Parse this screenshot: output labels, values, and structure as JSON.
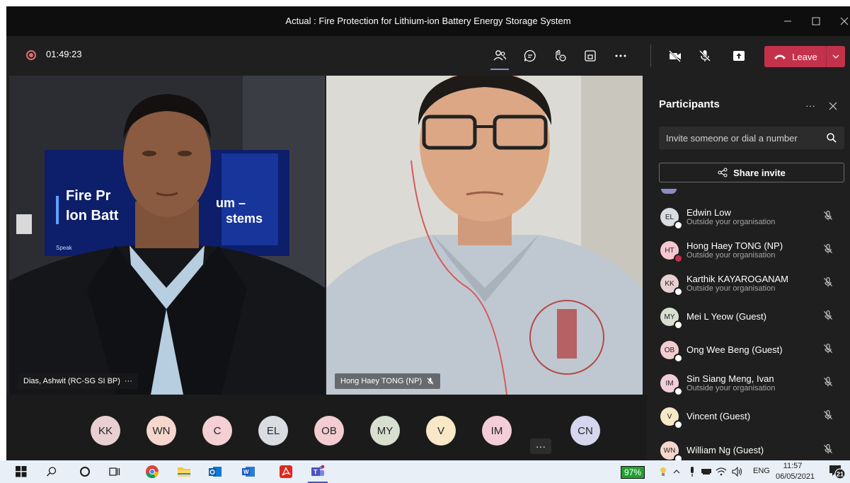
{
  "window": {
    "title": "Actual : Fire Protection for Lithium-ion Battery Energy Storage System"
  },
  "toolbar": {
    "elapsed": "01:49:23",
    "leave_label": "Leave"
  },
  "videos": [
    {
      "name": "Dias, Ashwit (RC-SG SI BP)",
      "more": "···",
      "slide_text": [
        "Fire Pr",
        "um –",
        "Ion Batt",
        "stems",
        "Speak"
      ]
    },
    {
      "name": "Hong Haey TONG (NP)"
    }
  ],
  "strip": {
    "avatars": [
      {
        "initials": "KK",
        "color": "#e8d0d2"
      },
      {
        "initials": "WN",
        "color": "#f6d7cd"
      },
      {
        "initials": "C",
        "color": "#f4cfd4"
      },
      {
        "initials": "EL",
        "color": "#d9dce1"
      },
      {
        "initials": "OB",
        "color": "#f2ccd1"
      },
      {
        "initials": "MY",
        "color": "#d8ded0"
      },
      {
        "initials": "V",
        "color": "#f8e8c6"
      },
      {
        "initials": "IM",
        "color": "#f3cdd7"
      },
      {
        "initials": "CN",
        "color": "#d6d7ee"
      }
    ],
    "more": "···"
  },
  "participants": {
    "title": "Participants",
    "more": "···",
    "search_placeholder": "Invite someone or dial a number",
    "share_label": "Share invite",
    "items": [
      {
        "initials": "EL",
        "name": "Edwin Low",
        "sub": "Outside your organisation",
        "color": "#d9dce1",
        "status": "#ffffff"
      },
      {
        "initials": "HT",
        "name": "Hong Haey TONG (NP)",
        "sub": "Outside your organisation",
        "color": "#f5c8d0",
        "status": "#c4314b"
      },
      {
        "initials": "KK",
        "name": "Karthik KAYAROGANAM",
        "sub": "Outside your organisation",
        "color": "#e8d0d2",
        "status": "#ffffff"
      },
      {
        "initials": "MY",
        "name": "Mei L Yeow (Guest)",
        "sub": "",
        "color": "#d8ded0",
        "status": "#ffffff"
      },
      {
        "initials": "OB",
        "name": "Ong Wee Beng (Guest)",
        "sub": "",
        "color": "#f2ccd1",
        "status": "#ffffff"
      },
      {
        "initials": "IM",
        "name": "Sin Siang Meng, Ivan",
        "sub": "Outside your organisation",
        "color": "#f3cdd7",
        "status": "#ffffff"
      },
      {
        "initials": "V",
        "name": "Vincent (Guest)",
        "sub": "",
        "color": "#f8e8c6",
        "status": "#ffffff"
      },
      {
        "initials": "WN",
        "name": "William Ng (Guest)",
        "sub": "",
        "color": "#f6d7cd",
        "status": "#ffffff"
      }
    ]
  },
  "taskbar": {
    "battery": "97%",
    "language": "ENG",
    "time": "11:57",
    "date": "06/05/2021",
    "notification_count": "21"
  },
  "colors": {
    "leave": "#c4314b",
    "accent": "#6264a7",
    "recording": "#e06c6c",
    "battery": "#21a12f"
  }
}
